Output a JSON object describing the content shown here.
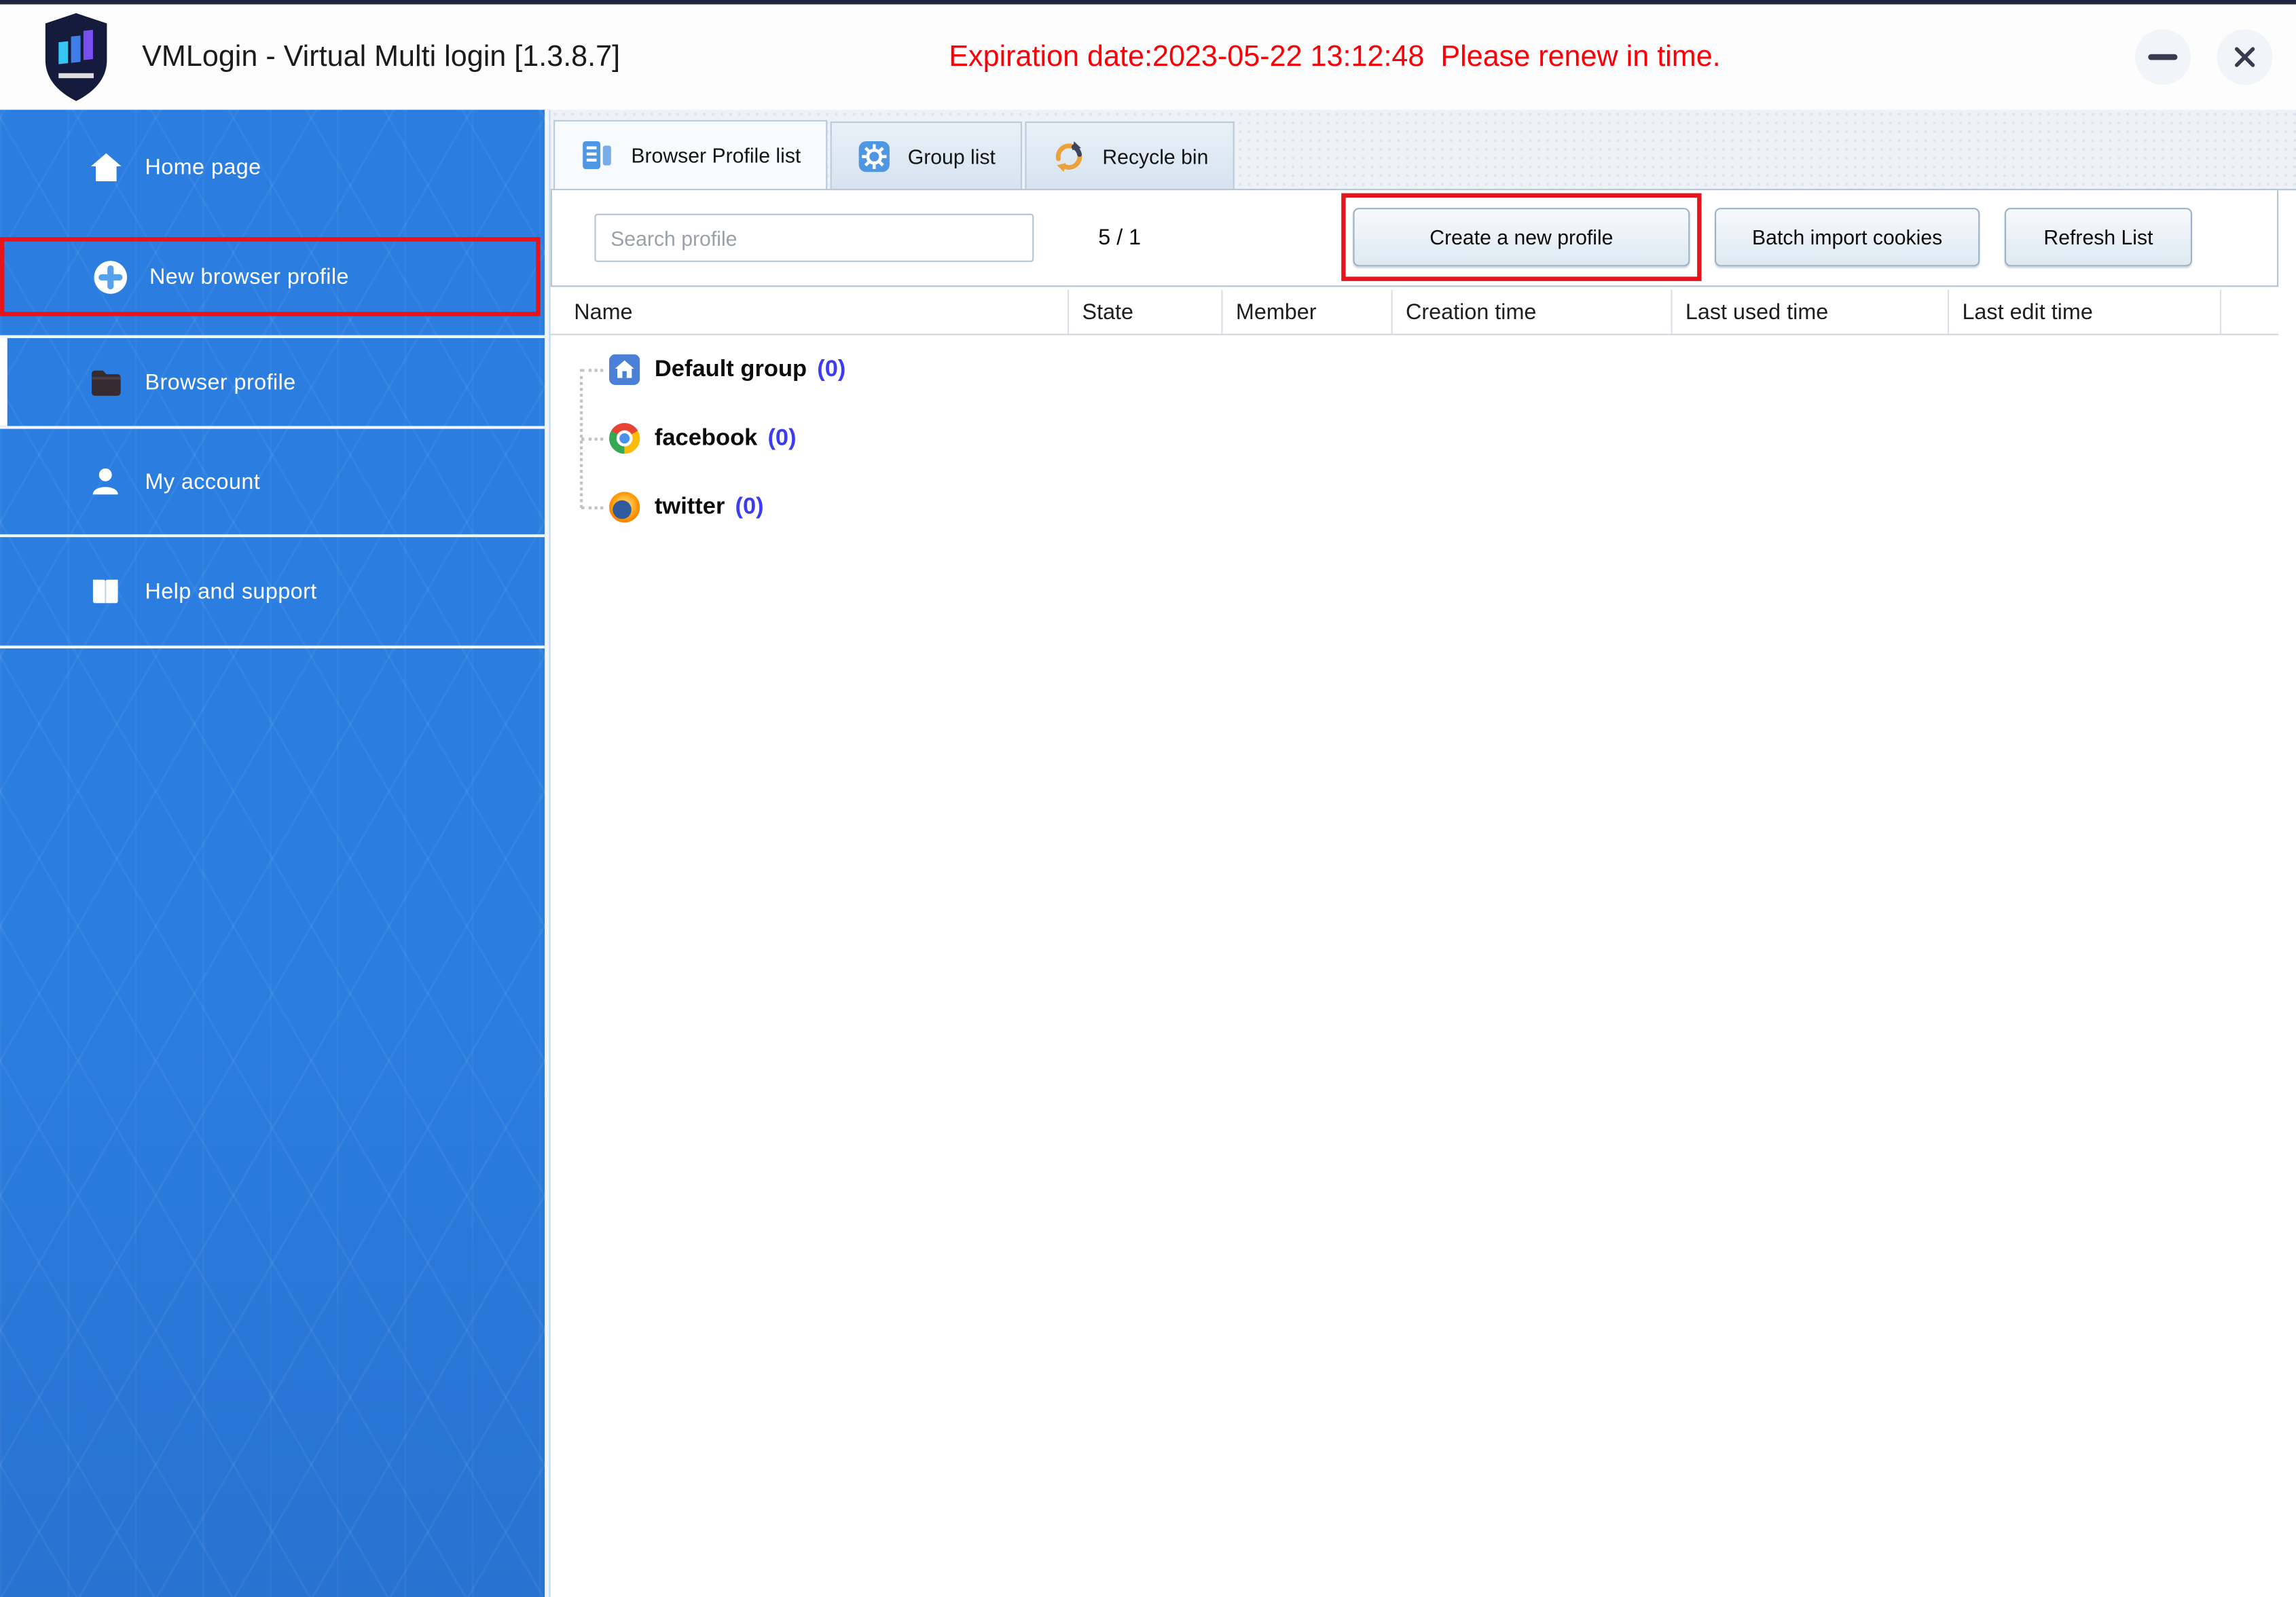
{
  "window": {
    "title": "VMLogin - Virtual Multi login [1.3.8.7]",
    "expiration_notice": "Expiration date:2023-05-22 13:12:48  Please renew in time.",
    "controls": {
      "minimize_icon": "minus-icon",
      "close_icon": "close-icon"
    }
  },
  "sidebar": {
    "items": [
      {
        "label": "Home page",
        "icon": "home-icon",
        "selected": false,
        "annotated": false
      },
      {
        "label": "New browser profile",
        "icon": "plus-circle-icon",
        "selected": false,
        "annotated": true
      },
      {
        "label": "Browser profile",
        "icon": "folder-icon",
        "selected": true,
        "annotated": false
      },
      {
        "label": "My account",
        "icon": "user-icon",
        "selected": false,
        "annotated": false
      },
      {
        "label": "Help and support",
        "icon": "book-icon",
        "selected": false,
        "annotated": false
      }
    ]
  },
  "tabs": [
    {
      "label": "Browser Profile list",
      "icon": "profile-list-icon",
      "active": true
    },
    {
      "label": "Group list",
      "icon": "gear-icon",
      "active": false
    },
    {
      "label": "Recycle bin",
      "icon": "recycle-icon",
      "active": false
    }
  ],
  "toolbar": {
    "search_placeholder": "Search profile",
    "count": "5 / 1",
    "buttons": [
      {
        "label": "Create a new profile",
        "annotated": true
      },
      {
        "label": "Batch import cookies",
        "annotated": false
      },
      {
        "label": "Refresh List",
        "annotated": false
      }
    ]
  },
  "table": {
    "columns": [
      "Name",
      "State",
      "Member",
      "Creation time",
      "Last used time",
      "Last edit time"
    ],
    "groups": [
      {
        "name": "Default group",
        "count": "(0)",
        "icon": "group-home-icon"
      },
      {
        "name": "facebook",
        "count": "(0)",
        "icon": "chrome-icon"
      },
      {
        "name": "twitter",
        "count": "(0)",
        "icon": "firefox-icon"
      }
    ]
  },
  "colors": {
    "sidebar_blue": "#2b7de0",
    "annotation_red": "#e8141c",
    "expiration_red": "#fa0007",
    "count_blue": "#3c3cf0",
    "tab_active_bg": "#f8fbfd",
    "panel_border": "#b2c4d5"
  }
}
